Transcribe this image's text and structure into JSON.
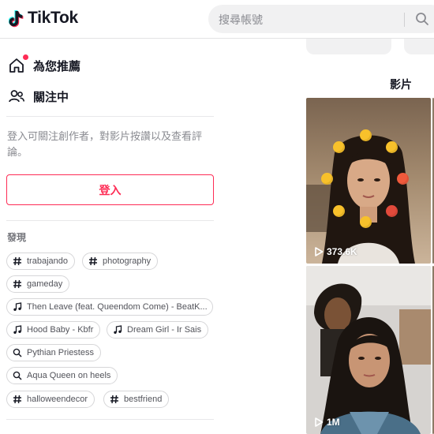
{
  "header": {
    "logo_text": "TikTok",
    "search_placeholder": "搜尋帳號"
  },
  "sidebar": {
    "nav": [
      {
        "label": "為您推薦",
        "icon": "home-icon",
        "has_notification_dot": true
      },
      {
        "label": "關注中",
        "icon": "following-icon"
      }
    ],
    "login_hint": "登入可關注創作者，對影片按讚以及查看評論。",
    "login_button": "登入",
    "discover_title": "發現",
    "tags": [
      {
        "type": "hashtag",
        "label": "trabajando"
      },
      {
        "type": "hashtag",
        "label": "photography"
      },
      {
        "type": "hashtag",
        "label": "gameday"
      },
      {
        "type": "music",
        "label": "Then Leave (feat. Queendom Come) - BeatK..."
      },
      {
        "type": "music",
        "label": "Hood Baby - Kbfr"
      },
      {
        "type": "music",
        "label": "Dream Girl - Ir Sais"
      },
      {
        "type": "search",
        "label": "Pythian Priestess"
      },
      {
        "type": "search",
        "label": "Aqua Queen on heels"
      },
      {
        "type": "hashtag",
        "label": "halloweendecor"
      },
      {
        "type": "hashtag",
        "label": "bestfriend"
      }
    ]
  },
  "main": {
    "tab_label": "影片",
    "videos": [
      {
        "views": "373.6K"
      },
      {
        "views": "1M"
      }
    ]
  },
  "colors": {
    "accent": "#fe2c55",
    "text_primary": "#161823",
    "text_secondary": "#8a8b91"
  }
}
